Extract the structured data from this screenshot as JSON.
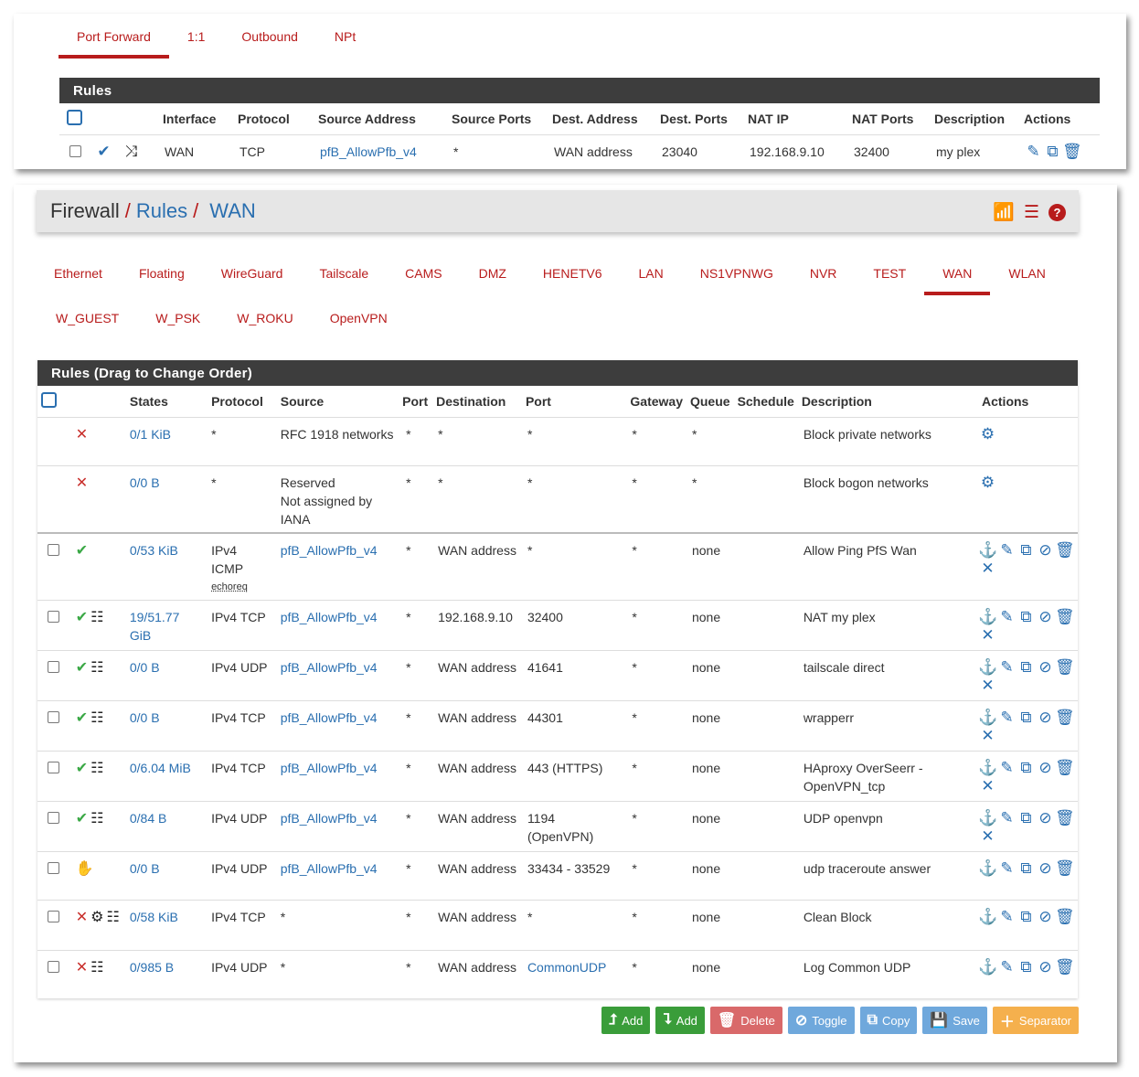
{
  "nat": {
    "tabs": [
      "Port Forward",
      "1:1",
      "Outbound",
      "NPt"
    ],
    "active_tab": 0,
    "title": "Rules",
    "columns": [
      "Interface",
      "Protocol",
      "Source Address",
      "Source Ports",
      "Dest. Address",
      "Dest. Ports",
      "NAT IP",
      "NAT Ports",
      "Description",
      "Actions"
    ],
    "row": {
      "interface": "WAN",
      "protocol": "TCP",
      "source_address": "pfB_AllowPfb_v4",
      "source_ports": "*",
      "dest_address": "WAN address",
      "dest_ports": "23040",
      "nat_ip": "192.168.9.10",
      "nat_ports": "32400",
      "description": "my plex"
    }
  },
  "breadcrumb": {
    "root": "Firewall",
    "sep": "/",
    "level1": "Rules",
    "level2": "WAN"
  },
  "header_icons": [
    "chart-icon",
    "list-icon",
    "help-icon"
  ],
  "iface_tabs_row1": [
    "Ethernet",
    "Floating",
    "WireGuard",
    "Tailscale",
    "CAMS",
    "DMZ",
    "HENETV6",
    "LAN",
    "NS1VPNWG",
    "NVR",
    "TEST",
    "WAN",
    "WLAN"
  ],
  "iface_tabs_row2": [
    "W_GUEST",
    "W_PSK",
    "W_ROKU",
    "OpenVPN"
  ],
  "active_iface": "WAN",
  "rules": {
    "title": "Rules (Drag to Change Order)",
    "columns": {
      "states": "States",
      "protocol": "Protocol",
      "source": "Source",
      "port": "Port",
      "destination": "Destination",
      "dport": "Port",
      "gateway": "Gateway",
      "queue": "Queue",
      "schedule": "Schedule",
      "description": "Description",
      "actions": "Actions"
    },
    "rows": [
      {
        "checkbox": false,
        "status": [
          "x"
        ],
        "states": "0/1 KiB",
        "protocol": [
          "*"
        ],
        "protocol_note": "",
        "source": "RFC 1918 networks",
        "source_link": false,
        "sport": "*",
        "destination": "*",
        "dport": "*",
        "dport_link": false,
        "gateway": "*",
        "queue": "*",
        "schedule": "",
        "description": "Block private networks",
        "actions": "gear"
      },
      {
        "checkbox": false,
        "status": [
          "x"
        ],
        "states": "0/0 B",
        "protocol": [
          "*"
        ],
        "protocol_note": "",
        "source": "Reserved\nNot assigned by IANA",
        "source_link": false,
        "sport": "*",
        "destination": "*",
        "dport": "*",
        "dport_link": false,
        "gateway": "*",
        "queue": "*",
        "schedule": "",
        "description": "Block bogon networks",
        "actions": "gear"
      },
      {
        "checkbox": true,
        "status": [
          "check"
        ],
        "states": "0/53 KiB",
        "protocol": [
          "IPv4",
          "ICMP"
        ],
        "protocol_note": "echoreq",
        "source": "pfB_AllowPfb_v4",
        "source_link": true,
        "sport": "*",
        "destination": "WAN address",
        "dport": "*",
        "dport_link": false,
        "gateway": "*",
        "queue": "none",
        "schedule": "",
        "description": "Allow Ping PfS Wan",
        "actions": "full"
      },
      {
        "checkbox": true,
        "status": [
          "check",
          "list"
        ],
        "states": "19/51.77 GiB",
        "protocol": [
          "IPv4 TCP"
        ],
        "protocol_note": "",
        "source": "pfB_AllowPfb_v4",
        "source_link": true,
        "sport": "*",
        "destination": "192.168.9.10",
        "dport": "32400",
        "dport_link": false,
        "gateway": "*",
        "queue": "none",
        "schedule": "",
        "description": "NAT my plex",
        "actions": "full"
      },
      {
        "checkbox": true,
        "status": [
          "check",
          "list"
        ],
        "states": "0/0 B",
        "protocol": [
          "IPv4 UDP"
        ],
        "protocol_note": "",
        "source": "pfB_AllowPfb_v4",
        "source_link": true,
        "sport": "*",
        "destination": "WAN address",
        "dport": "41641",
        "dport_link": false,
        "gateway": "*",
        "queue": "none",
        "schedule": "",
        "description": "tailscale direct",
        "actions": "full"
      },
      {
        "checkbox": true,
        "status": [
          "check",
          "list"
        ],
        "states": "0/0 B",
        "protocol": [
          "IPv4 TCP"
        ],
        "protocol_note": "",
        "source": "pfB_AllowPfb_v4",
        "source_link": true,
        "sport": "*",
        "destination": "WAN address",
        "dport": "44301",
        "dport_link": false,
        "gateway": "*",
        "queue": "none",
        "schedule": "",
        "description": "wrapperr",
        "actions": "full"
      },
      {
        "checkbox": true,
        "status": [
          "check",
          "list"
        ],
        "states": "0/6.04 MiB",
        "protocol": [
          "IPv4 TCP"
        ],
        "protocol_note": "",
        "source": "pfB_AllowPfb_v4",
        "source_link": true,
        "sport": "*",
        "destination": "WAN address",
        "dport": "443 (HTTPS)",
        "dport_link": false,
        "gateway": "*",
        "queue": "none",
        "schedule": "",
        "description": "HAproxy OverSeerr - OpenVPN_tcp",
        "actions": "full"
      },
      {
        "checkbox": true,
        "status": [
          "check",
          "list"
        ],
        "states": "0/84 B",
        "protocol": [
          "IPv4 UDP"
        ],
        "protocol_note": "",
        "source": "pfB_AllowPfb_v4",
        "source_link": true,
        "sport": "*",
        "destination": "WAN address",
        "dport": "1194\n(OpenVPN)",
        "dport_link": false,
        "gateway": "*",
        "queue": "none",
        "schedule": "",
        "description": "UDP openvpn",
        "actions": "full"
      },
      {
        "checkbox": true,
        "status": [
          "hand"
        ],
        "states": "0/0 B",
        "protocol": [
          "IPv4 UDP"
        ],
        "protocol_note": "",
        "source": "pfB_AllowPfb_v4",
        "source_link": true,
        "sport": "*",
        "destination": "WAN address",
        "dport": "33434 - 33529",
        "dport_link": false,
        "gateway": "*",
        "queue": "none",
        "schedule": "",
        "description": "udp traceroute answer",
        "actions": "nox"
      },
      {
        "checkbox": true,
        "status": [
          "x",
          "gear",
          "list"
        ],
        "states": "0/58 KiB",
        "protocol": [
          "IPv4 TCP"
        ],
        "protocol_note": "",
        "source": "*",
        "source_link": false,
        "sport": "*",
        "destination": "WAN address",
        "dport": "*",
        "dport_link": false,
        "gateway": "*",
        "queue": "none",
        "schedule": "",
        "description": "Clean Block",
        "actions": "nox"
      },
      {
        "checkbox": true,
        "status": [
          "x",
          "list"
        ],
        "states": "0/985 B",
        "protocol": [
          "IPv4 UDP"
        ],
        "protocol_note": "",
        "source": "*",
        "source_link": false,
        "sport": "*",
        "destination": "WAN address",
        "dport": "CommonUDP",
        "dport_link": true,
        "gateway": "*",
        "queue": "none",
        "schedule": "",
        "description": "Log Common UDP",
        "actions": "nox"
      }
    ]
  },
  "buttons": [
    {
      "label": "Add",
      "icon": "arrow-up-add-icon",
      "color": "#3a9d3a"
    },
    {
      "label": "Add",
      "icon": "arrow-down-add-icon",
      "color": "#3a9d3a"
    },
    {
      "label": "Delete",
      "icon": "trash-icon",
      "color": "#d9696a"
    },
    {
      "label": "Toggle",
      "icon": "ban-icon",
      "color": "#6fa8dc"
    },
    {
      "label": "Copy",
      "icon": "copy-icon",
      "color": "#6fa8dc"
    },
    {
      "label": "Save",
      "icon": "save-icon",
      "color": "#6fa8dc"
    },
    {
      "label": "Separator",
      "icon": "plus-icon",
      "color": "#f5b04d"
    }
  ],
  "colors": {
    "accent_red": "#b81c1c",
    "link_blue": "#2a6fb0",
    "header_dark": "#3d3d3d"
  }
}
